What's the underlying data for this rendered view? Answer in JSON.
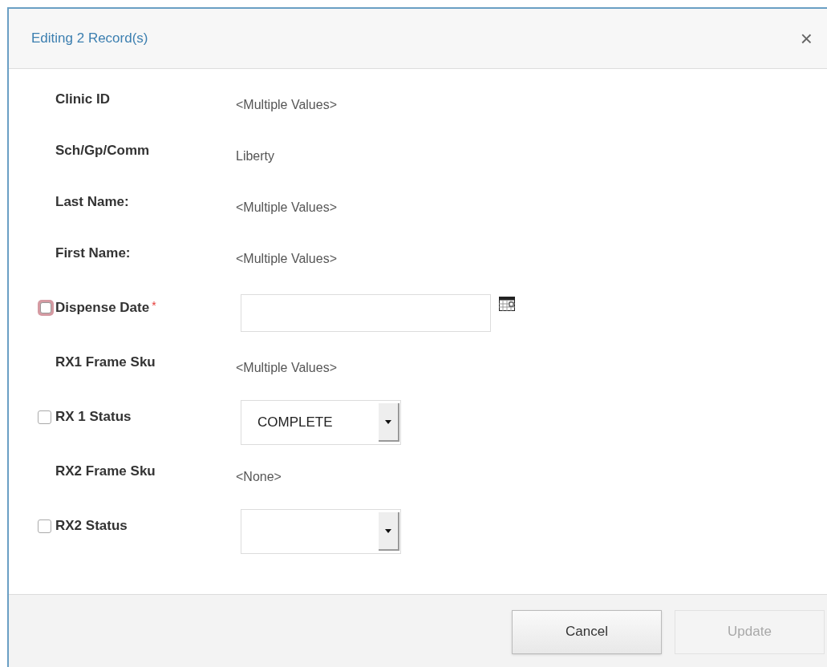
{
  "dialog": {
    "title": "Editing 2 Record(s)",
    "close": "×"
  },
  "fields": [
    {
      "kind": "text",
      "label": "Clinic ID",
      "value": "<Multiple Values>"
    },
    {
      "kind": "text",
      "label": "Sch/Gp/Comm",
      "value": "Liberty"
    },
    {
      "kind": "text",
      "label": "Last Name:",
      "value": "<Multiple Values>"
    },
    {
      "kind": "text",
      "label": "First Name:",
      "value": "<Multiple Values>"
    },
    {
      "kind": "date",
      "label": "Dispense Date",
      "required_mark": "*",
      "checkbox": {
        "checked": false,
        "invalid": true
      }
    },
    {
      "kind": "text",
      "label": "RX1 Frame Sku",
      "value": "<Multiple Values>"
    },
    {
      "kind": "select",
      "label": "RX 1 Status",
      "value": "COMPLETE",
      "checkbox": {
        "checked": false,
        "invalid": false
      }
    },
    {
      "kind": "text",
      "label": "RX2 Frame Sku",
      "value": "<None>"
    },
    {
      "kind": "select",
      "label": "RX2 Status",
      "checkbox": {
        "checked": false,
        "invalid": false
      }
    }
  ],
  "buttons": [
    {
      "label": "Cancel",
      "disabled": false
    },
    {
      "label": "Update",
      "disabled": true
    }
  ]
}
